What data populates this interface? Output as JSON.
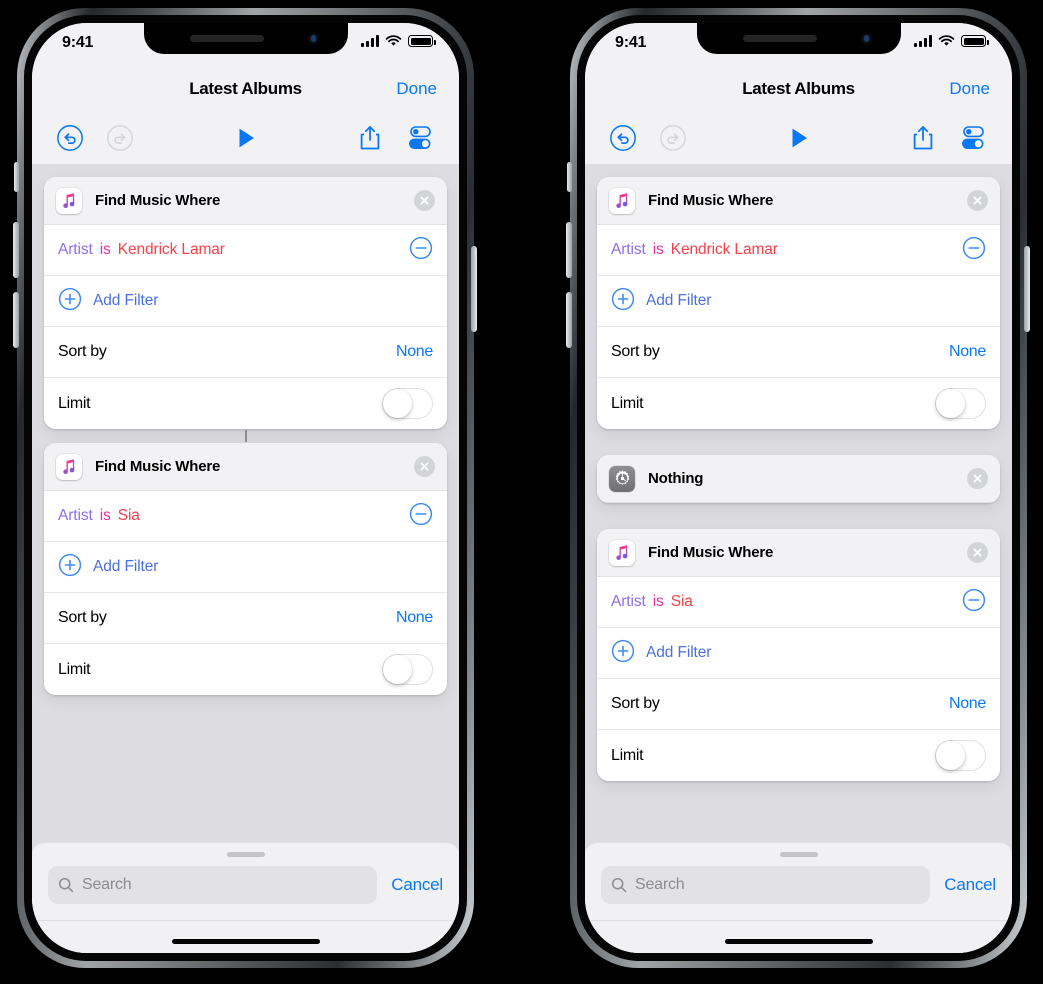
{
  "phones": [
    {
      "id": "left",
      "status": {
        "time": "9:41",
        "signal_icon": "cellular-signal-icon",
        "wifi_icon": "wifi-icon",
        "battery_icon": "battery-icon"
      },
      "nav": {
        "title": "Latest Albums",
        "done_label": "Done"
      },
      "toolbar": {
        "undo_icon": "undo-icon",
        "redo_icon": "redo-icon",
        "play_icon": "play-icon",
        "share_icon": "share-icon",
        "settings_icon": "settings-toggles-icon"
      },
      "cards": [
        {
          "kind": "find-music",
          "icon": "apple-music-icon",
          "title": "Find Music Where",
          "close_icon": "close-icon",
          "filter": {
            "field": "Artist",
            "operator": "is",
            "value": "Kendrick Lamar",
            "remove_icon": "minus-circle-icon"
          },
          "add_filter": {
            "icon": "plus-circle-icon",
            "label": "Add Filter"
          },
          "sort": {
            "label": "Sort by",
            "value": "None"
          },
          "limit": {
            "label": "Limit",
            "enabled": false
          }
        },
        {
          "kind": "find-music",
          "icon": "apple-music-icon",
          "title": "Find Music Where",
          "close_icon": "close-icon",
          "filter": {
            "field": "Artist",
            "operator": "is",
            "value": "Sia",
            "remove_icon": "minus-circle-icon"
          },
          "add_filter": {
            "icon": "plus-circle-icon",
            "label": "Add Filter"
          },
          "sort": {
            "label": "Sort by",
            "value": "None"
          },
          "limit": {
            "label": "Limit",
            "enabled": false
          }
        }
      ],
      "sheet": {
        "search_placeholder": "Search",
        "search_value": "",
        "search_icon": "search-icon",
        "cancel_label": "Cancel",
        "grabber": "sheet-grabber"
      }
    },
    {
      "id": "right",
      "status": {
        "time": "9:41",
        "signal_icon": "cellular-signal-icon",
        "wifi_icon": "wifi-icon",
        "battery_icon": "battery-icon"
      },
      "nav": {
        "title": "Latest Albums",
        "done_label": "Done"
      },
      "toolbar": {
        "undo_icon": "undo-icon",
        "redo_icon": "redo-icon",
        "play_icon": "play-icon",
        "share_icon": "share-icon",
        "settings_icon": "settings-toggles-icon"
      },
      "cards": [
        {
          "kind": "find-music",
          "icon": "apple-music-icon",
          "title": "Find Music Where",
          "close_icon": "close-icon",
          "filter": {
            "field": "Artist",
            "operator": "is",
            "value": "Kendrick Lamar",
            "remove_icon": "minus-circle-icon"
          },
          "add_filter": {
            "icon": "plus-circle-icon",
            "label": "Add Filter"
          },
          "sort": {
            "label": "Sort by",
            "value": "None"
          },
          "limit": {
            "label": "Limit",
            "enabled": false
          }
        },
        {
          "kind": "nothing",
          "icon": "gear-icon",
          "title": "Nothing",
          "close_icon": "close-icon"
        },
        {
          "kind": "find-music",
          "icon": "apple-music-icon",
          "title": "Find Music Where",
          "close_icon": "close-icon",
          "filter": {
            "field": "Artist",
            "operator": "is",
            "value": "Sia",
            "remove_icon": "minus-circle-icon"
          },
          "add_filter": {
            "icon": "plus-circle-icon",
            "label": "Add Filter"
          },
          "sort": {
            "label": "Sort by",
            "value": "None"
          },
          "limit": {
            "label": "Limit",
            "enabled": false
          }
        }
      ],
      "sheet": {
        "search_placeholder": "Search",
        "search_value": "",
        "search_icon": "search-icon",
        "cancel_label": "Cancel",
        "grabber": "sheet-grabber"
      }
    }
  ],
  "colors": {
    "accent_blue": "#0a78f5",
    "field_purple": "#8e6fe8",
    "operator_pink": "#e9329a",
    "value_red": "#f8414a",
    "add_filter_blue": "#4b6ee0",
    "canvas_gray": "#dcdce1",
    "chrome_gray": "#f2f2f5"
  }
}
